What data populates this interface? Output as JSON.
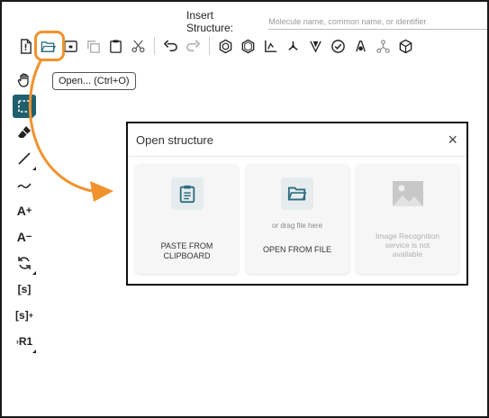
{
  "insert_structure": {
    "label": "Insert Structure:",
    "placeholder": "Molecule name, common name, or identifier"
  },
  "toolbar": {
    "icons": [
      "new-document-icon",
      "open-folder-icon",
      "save-icon",
      "copy-icon",
      "paste-icon",
      "cut-icon",
      "undo-icon",
      "redo-icon",
      "aromatize-icon",
      "dearomatize-icon",
      "layout-icon",
      "clean-icon",
      "stereo-icon",
      "check-icon",
      "calculate-icon",
      "hydrogen-icon",
      "3d-viewer-icon"
    ]
  },
  "tooltip": {
    "text": "Open... (Ctrl+O)"
  },
  "left_toolbar": {
    "charge_plus_label": "A",
    "charge_minus_label": "A",
    "sgroup_label": "[s]",
    "sgroup_add_label": "[s]",
    "rgroup_label": "R1"
  },
  "dialog": {
    "title": "Open structure",
    "close": "×",
    "cards": {
      "paste": {
        "label_line1": "PASTE FROM",
        "label_line2": "CLIPBOARD"
      },
      "open_file": {
        "hint": "or drag file here",
        "label": "OPEN FROM FILE"
      },
      "image_recognition": {
        "line1": "Image Recognition",
        "line2": "service is not",
        "line3": "available"
      }
    }
  },
  "colors": {
    "accent": "#f0922d",
    "selected_tool": "#1f5f6e",
    "icon_teal": "#2d6e7e"
  }
}
